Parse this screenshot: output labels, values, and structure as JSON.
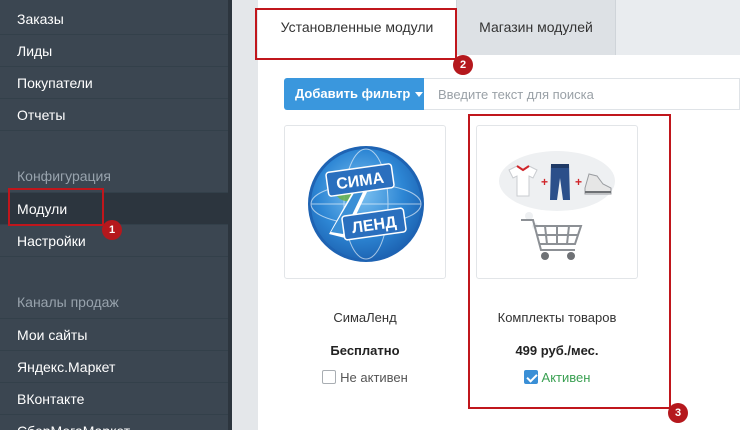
{
  "sidebar": {
    "items_top": [
      {
        "label": "Заказы"
      },
      {
        "label": "Лиды"
      },
      {
        "label": "Покупатели"
      },
      {
        "label": "Отчеты"
      }
    ],
    "config_section": "Конфигурация",
    "config_items": [
      {
        "label": "Модули",
        "active": true
      },
      {
        "label": "Настройки"
      }
    ],
    "sales_section": "Каналы продаж",
    "sales_items": [
      {
        "label": "Мои сайты"
      },
      {
        "label": "Яндекс.Маркет"
      },
      {
        "label": "ВКонтакте"
      },
      {
        "label": "СберМегаМаркет"
      }
    ]
  },
  "tabs": [
    {
      "label": "Установленные модули",
      "active": true
    },
    {
      "label": "Магазин модулей"
    }
  ],
  "filter": {
    "button_label": "Добавить фильтр",
    "search_placeholder": "Введите текст для поиска"
  },
  "modules": [
    {
      "name": "СимаЛенд",
      "price": "Бесплатно",
      "status": "Не активен",
      "active": false,
      "logo_text_1": "СИМА",
      "logo_text_2": "ЛЕНД"
    },
    {
      "name": "Комплекты товаров",
      "price": "499 руб./мес.",
      "status": "Активен",
      "active": true
    }
  ],
  "callouts": [
    "1",
    "2",
    "3"
  ],
  "colors": {
    "sidebar_bg": "#3b4651",
    "accent_blue": "#3a97dd",
    "active_green": "#3aa052",
    "callout_red": "#c0161c"
  }
}
